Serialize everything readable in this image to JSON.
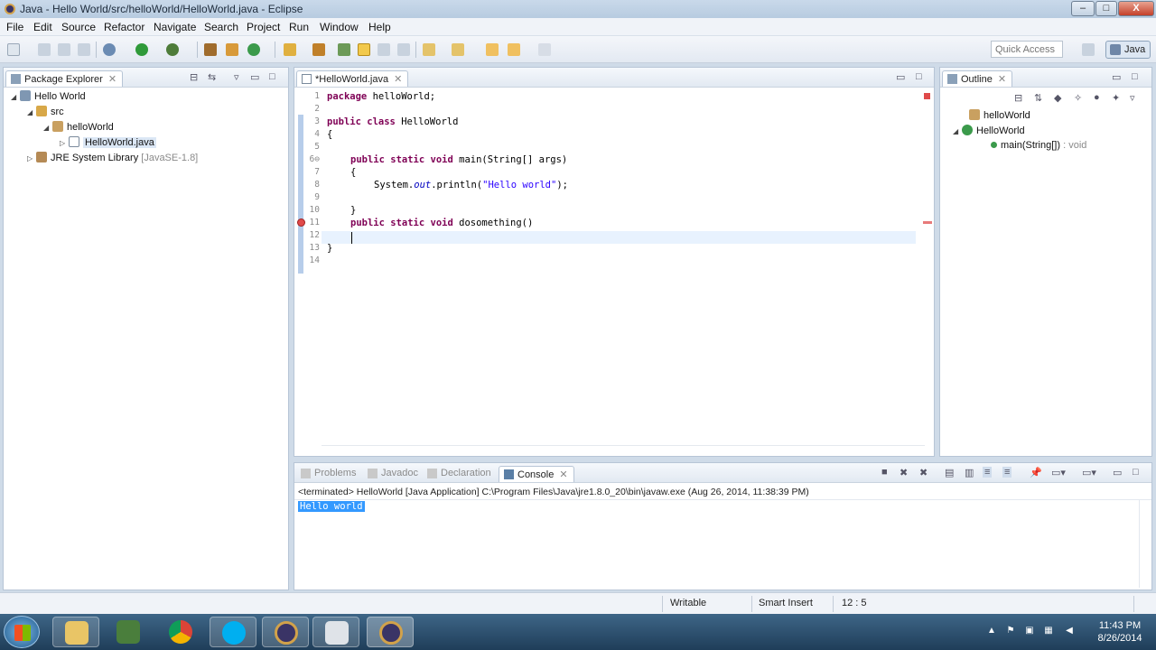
{
  "window": {
    "title": "Java - Hello World/src/helloWorld/HelloWorld.java - Eclipse",
    "min": "–",
    "max": "□",
    "close": "X"
  },
  "menu": [
    "File",
    "Edit",
    "Source",
    "Refactor",
    "Navigate",
    "Search",
    "Project",
    "Run",
    "Window",
    "Help"
  ],
  "toolbar": {
    "quick_access_placeholder": "Quick Access",
    "perspective": "Java"
  },
  "package_explorer": {
    "tab": "Package Explorer",
    "tree": [
      {
        "label": "Hello World",
        "icon": "project-icon"
      },
      {
        "label": "src",
        "icon": "source-folder-icon"
      },
      {
        "label": "helloWorld",
        "icon": "package-icon"
      },
      {
        "label": "HelloWorld.java",
        "icon": "java-file-icon"
      },
      {
        "label": "JRE System Library",
        "suffix": "[JavaSE-1.8]",
        "icon": "library-icon"
      }
    ]
  },
  "editor": {
    "tab": "*HelloWorld.java",
    "lines": [
      "1",
      "2",
      "3",
      "4",
      "5",
      "6⊖",
      "7",
      "8",
      "9",
      "10",
      "11",
      "12",
      "13",
      "14"
    ],
    "code": {
      "l1_kw": "package",
      "l1_rest": " helloWorld;",
      "l3_kw1": "public",
      "l3_kw2": " class",
      "l3_rest": " HelloWorld",
      "l4": "{",
      "l6_kw": "public static void",
      "l6_rest": " main(String[] args)",
      "l7": "{",
      "l8_a": "System.",
      "l8_field": "out",
      "l8_b": ".println(",
      "l8_str": "\"Hello world\"",
      "l8_c": ");",
      "l10": "}",
      "l11_kw": "public static void",
      "l11_rest": " dosomething()",
      "l13": "}"
    }
  },
  "outline": {
    "tab": "Outline",
    "items": [
      {
        "label": "helloWorld",
        "icon": "package-icon"
      },
      {
        "label": "HelloWorld",
        "icon": "class-icon"
      },
      {
        "label": "main(String[])",
        "suffix": " : void",
        "icon": "method-icon"
      }
    ]
  },
  "bottom_tabs": [
    "Problems",
    "Javadoc",
    "Declaration",
    "Console"
  ],
  "console": {
    "header": "<terminated> HelloWorld [Java Application] C:\\Program Files\\Java\\jre1.8.0_20\\bin\\javaw.exe (Aug 26, 2014, 11:38:39 PM)",
    "output": "Hello world"
  },
  "status": {
    "writable": "Writable",
    "insert_mode": "Smart Insert",
    "position": "12 : 5"
  },
  "taskbar": {
    "time": "11:43 PM",
    "date": "8/26/2014"
  }
}
